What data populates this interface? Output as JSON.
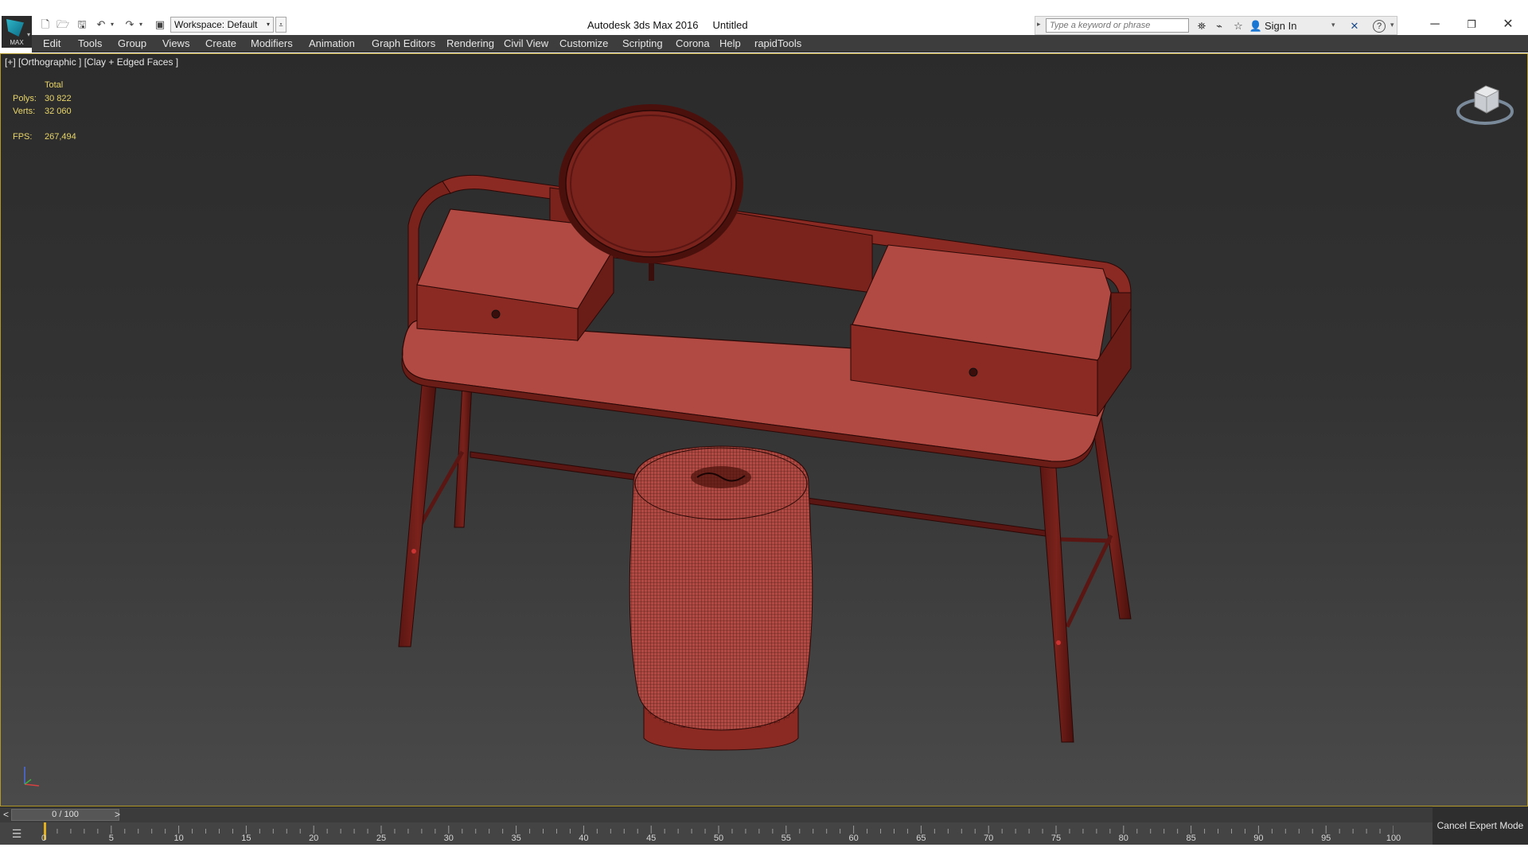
{
  "app": {
    "logo_text": "MAX",
    "title": "Autodesk 3ds Max 2016",
    "document": "Untitled"
  },
  "quick_access": {
    "workspace_label": "Workspace: Default"
  },
  "search": {
    "placeholder": "Type a keyword or phrase",
    "sign_in": "Sign In"
  },
  "menu": [
    "Edit",
    "Tools",
    "Group",
    "Views",
    "Create",
    "Modifiers",
    "Animation",
    "Graph Editors",
    "Rendering",
    "Civil View",
    "Customize",
    "Scripting",
    "Corona",
    "Help",
    "rapidTools"
  ],
  "viewport": {
    "label": "[+] [Orthographic ] [Clay + Edged Faces ]",
    "stats": {
      "header": "Total",
      "polys_label": "Polys:",
      "polys_value": "30 822",
      "verts_label": "Verts:",
      "verts_value": "32 060",
      "fps_label": "FPS:",
      "fps_value": "267,494"
    }
  },
  "timeline": {
    "current": "0 / 100",
    "prev": "<",
    "next": ">",
    "ticks": [
      "0",
      "5",
      "10",
      "15",
      "20",
      "25",
      "30",
      "35",
      "40",
      "45",
      "50",
      "55",
      "60",
      "65",
      "70",
      "75",
      "80",
      "85",
      "90",
      "95",
      "100"
    ]
  },
  "status": {
    "cancel_expert": "Cancel Expert Mode"
  },
  "colors": {
    "viewport_bg": "#333333",
    "clay_face": "#b04a42",
    "clay_dark": "#7a221c",
    "wire": "#3a0e0b",
    "stat_text": "#e8d56a"
  }
}
